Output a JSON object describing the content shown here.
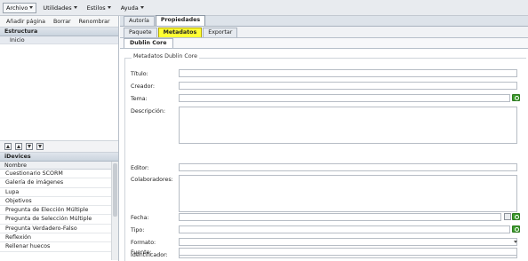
{
  "menubar": {
    "items": [
      {
        "label": "Archivo"
      },
      {
        "label": "Utilidades"
      },
      {
        "label": "Estilos"
      },
      {
        "label": "Ayuda"
      }
    ]
  },
  "left": {
    "toolbar": {
      "add": "Añadir página",
      "delete": "Borrar",
      "rename": "Renombrar"
    },
    "structure_header": "Estructura",
    "tree": [
      {
        "label": "Inicio"
      }
    ],
    "arrow_icons": [
      "move-top-icon",
      "move-up-icon",
      "move-down-icon",
      "move-bottom-icon"
    ],
    "idevices_header": "iDevices",
    "idevices_column": "Nombre",
    "idevices": [
      "Cuestionario SCORM",
      "Galería de imágenes",
      "Lupa",
      "Objetivos",
      "Pregunta de Elección Múltiple",
      "Pregunta de Selección Múltiple",
      "Pregunta Verdadero-Falso",
      "Reflexión",
      "Rellenar huecos"
    ]
  },
  "tabs": {
    "top": [
      {
        "label": "Autoría"
      },
      {
        "label": "Propiedades"
      }
    ],
    "second": [
      {
        "label": "Paquete"
      },
      {
        "label": "Metadatos"
      },
      {
        "label": "Exportar"
      }
    ],
    "third": [
      {
        "label": "Dublin Core"
      }
    ]
  },
  "form": {
    "legend": "Metadatos Dublin Core",
    "fields": {
      "titulo": "Título:",
      "creador": "Creador:",
      "tema": "Tema:",
      "descripcion": "Descripción:",
      "editor": "Editor:",
      "colaboradores": "Colaboradores:",
      "fecha": "Fecha:",
      "tipo": "Tipo:",
      "formato": "Formato:",
      "identificador": "Identificador:",
      "fuente": "Fuente:"
    }
  },
  "colors": {
    "accent_tab": "#ffff33",
    "add_button": "#3c9a2c"
  }
}
